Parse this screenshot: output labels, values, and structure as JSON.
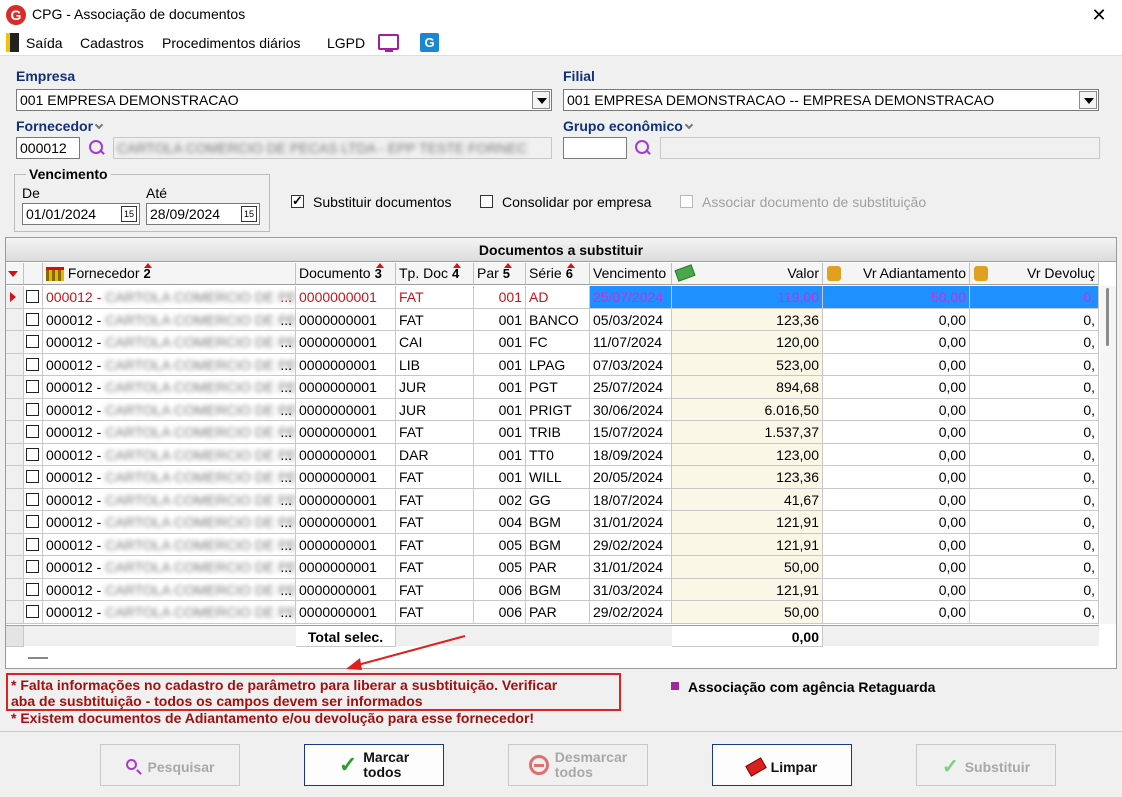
{
  "window": {
    "title": "CPG - Associação de documentos",
    "logo_letter": "G",
    "close_glyph": "✕"
  },
  "menu": {
    "items": [
      "Saída",
      "Cadastros",
      "Procedimentos diários",
      "LGPD"
    ],
    "app_icon_letter": "G"
  },
  "filters": {
    "empresa_label": "Empresa",
    "empresa_value": "001 EMPRESA DEMONSTRACAO",
    "filial_label": "Filial",
    "filial_value": "001 EMPRESA DEMONSTRACAO -- EMPRESA DEMONSTRACAO",
    "fornecedor_label": "Fornecedor",
    "fornecedor_code": "000012",
    "fornecedor_name": "CARTOLA COMERCIO DE PECAS LTDA - EPP TESTE FORNEC",
    "grupo_label": "Grupo econômico",
    "grupo_code": "",
    "grupo_name": "",
    "vencimento_label": "Vencimento",
    "de_label": "De",
    "de_value": "01/01/2024",
    "ate_label": "Até",
    "ate_value": "28/09/2024",
    "calendar_glyph": "15",
    "substituir_label": "Substituir documentos",
    "substituir_checked": true,
    "consolidar_label": "Consolidar por empresa",
    "consolidar_checked": false,
    "associar_label": "Associar documento de substituição",
    "associar_checked": false
  },
  "grid": {
    "title": "Documentos a substituir",
    "columns": {
      "fornecedor": "Fornecedor",
      "fornecedor_num": "2",
      "documento": "Documento",
      "documento_num": "3",
      "tpdoc": "Tp. Doc",
      "tpdoc_num": "4",
      "par": "Par",
      "par_num": "5",
      "serie": "Série",
      "serie_num": "6",
      "vencimento": "Vencimento",
      "valor": "Valor",
      "adiant": "Vr Adiantamento",
      "devol": "Vr Devoluç"
    },
    "rows": [
      {
        "forn": "000012 -",
        "doc": "0000000001",
        "tp": "FAT",
        "par": "001",
        "serie": "AD",
        "venc": "25/07/2024",
        "valor": "119,00",
        "adiant": "50,00",
        "devol": "0,"
      },
      {
        "forn": "000012 -",
        "doc": "0000000001",
        "tp": "FAT",
        "par": "001",
        "serie": "BANCO",
        "venc": "05/03/2024",
        "valor": "123,36",
        "adiant": "0,00",
        "devol": "0,"
      },
      {
        "forn": "000012 -",
        "doc": "0000000001",
        "tp": "CAI",
        "par": "001",
        "serie": "FC",
        "venc": "11/07/2024",
        "valor": "120,00",
        "adiant": "0,00",
        "devol": "0,"
      },
      {
        "forn": "000012 -",
        "doc": "0000000001",
        "tp": "LIB",
        "par": "001",
        "serie": "LPAG",
        "venc": "07/03/2024",
        "valor": "523,00",
        "adiant": "0,00",
        "devol": "0,"
      },
      {
        "forn": "000012 -",
        "doc": "0000000001",
        "tp": "JUR",
        "par": "001",
        "serie": "PGT",
        "venc": "25/07/2024",
        "valor": "894,68",
        "adiant": "0,00",
        "devol": "0,"
      },
      {
        "forn": "000012 -",
        "doc": "0000000001",
        "tp": "JUR",
        "par": "001",
        "serie": "PRIGT",
        "venc": "30/06/2024",
        "valor": "6.016,50",
        "adiant": "0,00",
        "devol": "0,"
      },
      {
        "forn": "000012 -",
        "doc": "0000000001",
        "tp": "FAT",
        "par": "001",
        "serie": "TRIB",
        "venc": "15/07/2024",
        "valor": "1.537,37",
        "adiant": "0,00",
        "devol": "0,"
      },
      {
        "forn": "000012 -",
        "doc": "0000000001",
        "tp": "DAR",
        "par": "001",
        "serie": "TT0",
        "venc": "18/09/2024",
        "valor": "123,00",
        "adiant": "0,00",
        "devol": "0,"
      },
      {
        "forn": "000012 -",
        "doc": "0000000001",
        "tp": "FAT",
        "par": "001",
        "serie": "WILL",
        "venc": "20/05/2024",
        "valor": "123,36",
        "adiant": "0,00",
        "devol": "0,"
      },
      {
        "forn": "000012 -",
        "doc": "0000000001",
        "tp": "FAT",
        "par": "002",
        "serie": "GG",
        "venc": "18/07/2024",
        "valor": "41,67",
        "adiant": "0,00",
        "devol": "0,"
      },
      {
        "forn": "000012 -",
        "doc": "0000000001",
        "tp": "FAT",
        "par": "004",
        "serie": "BGM",
        "venc": "31/01/2024",
        "valor": "121,91",
        "adiant": "0,00",
        "devol": "0,"
      },
      {
        "forn": "000012 -",
        "doc": "0000000001",
        "tp": "FAT",
        "par": "005",
        "serie": "BGM",
        "venc": "29/02/2024",
        "valor": "121,91",
        "adiant": "0,00",
        "devol": "0,"
      },
      {
        "forn": "000012 -",
        "doc": "0000000001",
        "tp": "FAT",
        "par": "005",
        "serie": "PAR",
        "venc": "31/01/2024",
        "valor": "50,00",
        "adiant": "0,00",
        "devol": "0,"
      },
      {
        "forn": "000012 -",
        "doc": "0000000001",
        "tp": "FAT",
        "par": "006",
        "serie": "BGM",
        "venc": "31/03/2024",
        "valor": "121,91",
        "adiant": "0,00",
        "devol": "0,"
      },
      {
        "forn": "000012 -",
        "doc": "0000000001",
        "tp": "FAT",
        "par": "006",
        "serie": "PAR",
        "venc": "29/02/2024",
        "valor": "50,00",
        "adiant": "0,00",
        "devol": "0,"
      }
    ],
    "blurred_name": "CARTOLA COMERCIO DE PECAS",
    "ellipsis": "...",
    "total_label": "Total selec.",
    "total_value": "0,00"
  },
  "messages": {
    "line1": "* Falta informações no cadastro de parâmetro para liberar a susbtituição. Verificar",
    "line2": "aba de susbtituição - todos os campos devem ser informados",
    "line3": "* Existem documentos de Adiantamento e/ou devolução para esse fornecedor!",
    "legend": "Associação com agência Retaguarda",
    "legend_color": "#a0289a"
  },
  "buttons": {
    "pesquisar": "Pesquisar",
    "marcar_1": "Marcar",
    "marcar_2": "todos",
    "desmarcar_1": "Desmarcar",
    "desmarcar_2": "todos",
    "limpar": "Limpar",
    "substituir": "Substituir"
  }
}
